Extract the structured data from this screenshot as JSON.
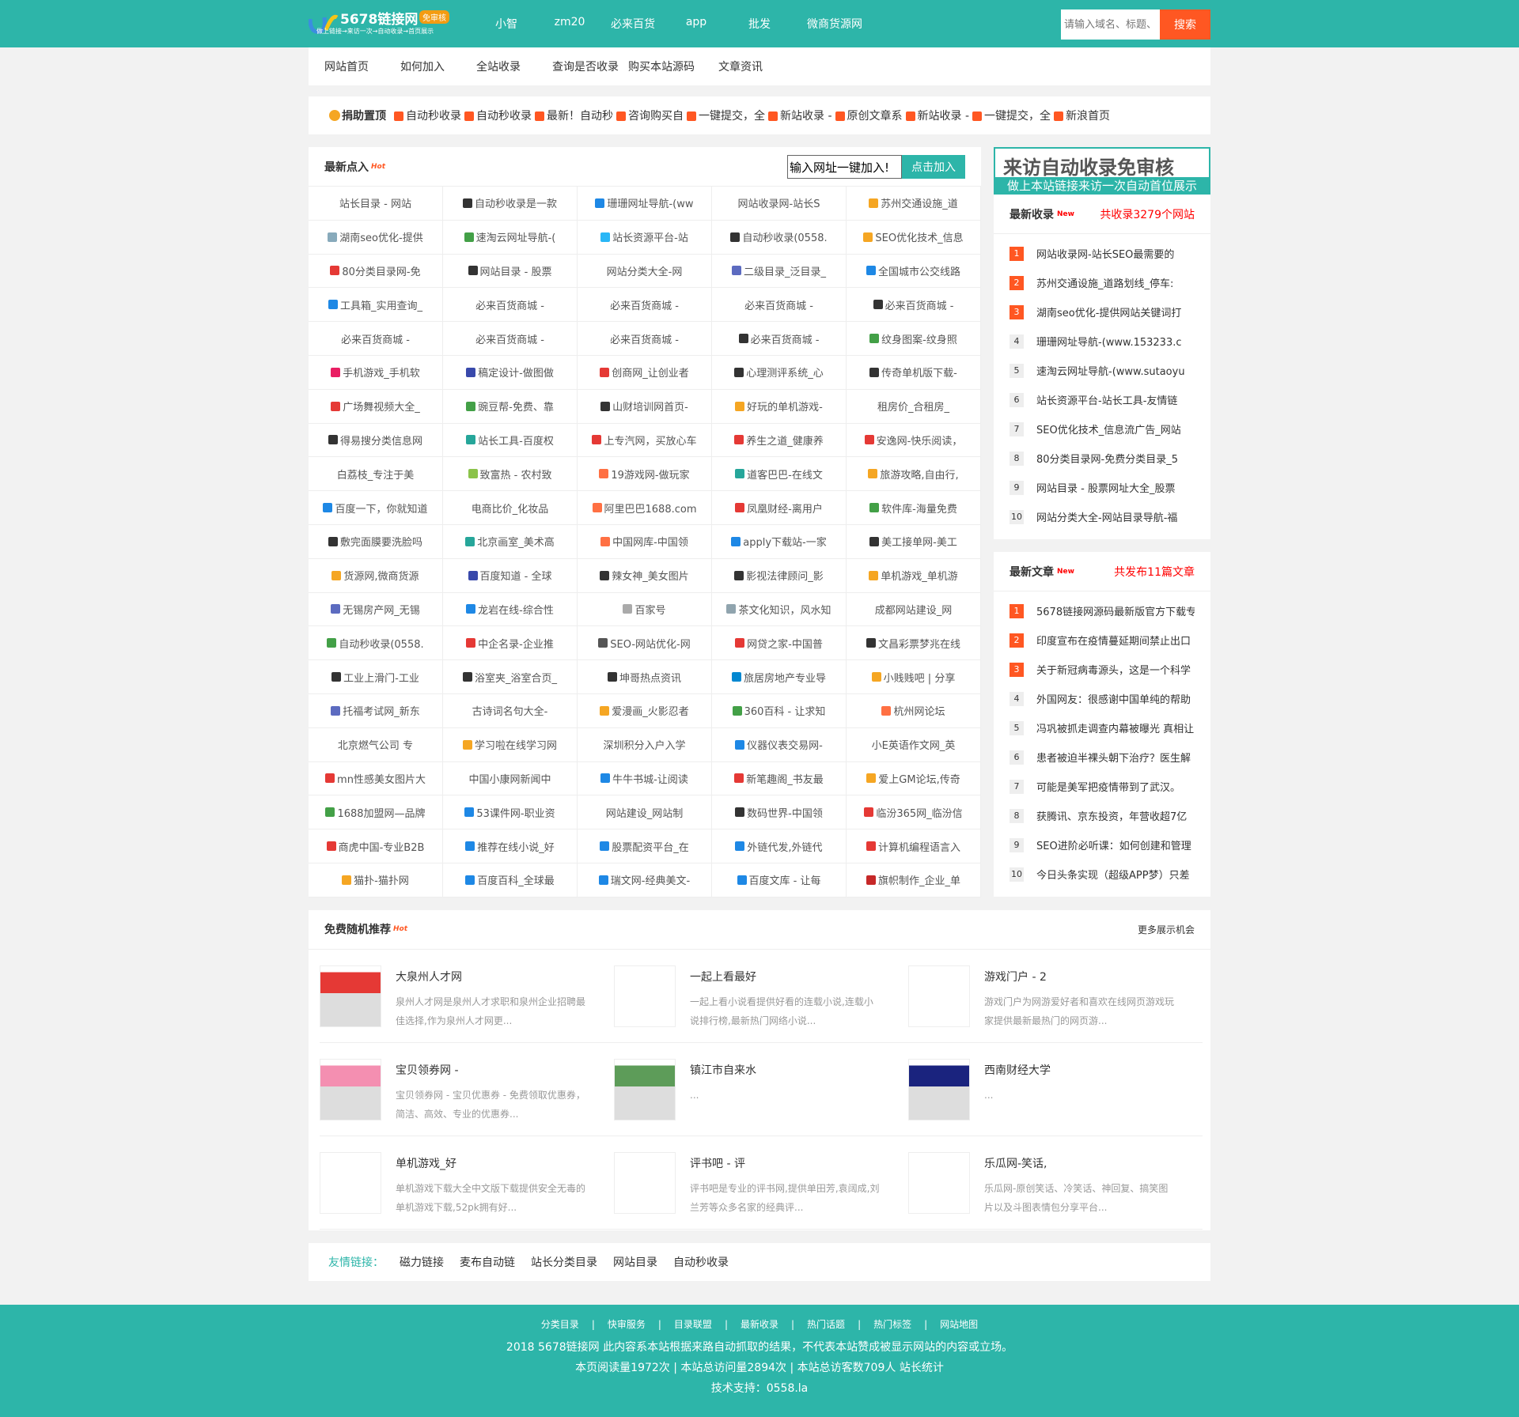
{
  "header": {
    "logo_text": "5678链接网",
    "logo_badge": "免审核",
    "logo_sub": "做上链接→来访一次→自动收录→首页展示",
    "nav": [
      "小智",
      "zm20",
      "必来百货",
      "app",
      "批发",
      "微商货源网"
    ],
    "search_placeholder": "请输入域名、标题、",
    "search_button": "搜索"
  },
  "subnav": [
    "网站首页",
    "如何加入",
    "全站收录",
    "查询是否收录",
    "购买本站源码",
    "文章资讯"
  ],
  "sponsor": {
    "title": "捐助置顶",
    "items": [
      "自动秒收录",
      "自动秒收录",
      "最新！自动秒",
      "咨询购买自",
      "一键提交，全",
      "新站收录 -",
      "原创文章系",
      "新站收录 -",
      "一键提交，全",
      "新浪首页"
    ]
  },
  "latest": {
    "title": "最新点入",
    "hot": "Hot",
    "input_value": "输入网址一键加入!",
    "button": "点击加入",
    "sites": [
      "站长目录 - 网站",
      "自动秒收录是一款",
      "珊珊网址导航-(ww",
      "网站收录网-站长S",
      "苏州交通设施_道",
      "湖南seo优化-提供",
      "速淘云网址导航-(",
      "站长资源平台-站",
      "自动秒收录(0558.",
      "SEO优化技术_信息",
      "80分类目录网-免",
      "网站目录 - 股票",
      "网站分类大全-网",
      "二级目录_泛目录_",
      "全国城市公交线路",
      "工具箱_实用查询_",
      "必来百货商城 -",
      "必来百货商城 -",
      "必来百货商城 -",
      "必来百货商城 -",
      "必来百货商城 -",
      "必来百货商城 -",
      "必来百货商城 -",
      "必来百货商城 -",
      "纹身图案-纹身照",
      "手机游戏_手机软",
      "稿定设计-做图做",
      "创商网_让创业者",
      "心理测评系统_心",
      "传奇单机版下载-",
      "广场舞视频大全_",
      "豌豆帮-免费、靠",
      "山财培训网首页-",
      "好玩的单机游戏-",
      "租房价_合租房_",
      "得易搜分类信息网",
      "站长工具-百度权",
      "上专汽网，买放心车",
      "养生之道_健康养",
      "安逸网-快乐阅读，",
      "白荔枝_专注于美",
      "致富热 - 农村致",
      "19游戏网-做玩家",
      "道客巴巴-在线文",
      "旅游攻略,自由行,",
      "百度一下，你就知道",
      "电商比价_化妆品",
      "阿里巴巴1688.com",
      "凤凰财经-离用户",
      "软件库-海量免费",
      "敷完面膜要洗脸吗",
      "北京画室_美术高",
      "中国网库-中国领",
      "apply下载站-一家",
      "美工接单网-美工",
      "货源网,微商货源",
      "百度知道 - 全球",
      "辣女神_美女图片",
      "影视法律顾问_影",
      "单机游戏_单机游",
      "无锡房产网_无锡",
      "龙岩在线-综合性",
      "百家号",
      "茶文化知识，风水知",
      "成都网站建设_网",
      "自动秒收录(0558.",
      "中企名录-企业推",
      "SEO-网站优化-网",
      "网贷之家-中国普",
      "文昌彩票梦兆在线",
      "工业上滑门-工业",
      "浴室夹_浴室合页_",
      "坤哥热点资讯",
      "旅居房地产专业导",
      "小贱贱吧 | 分享",
      "托福考试网_新东",
      "古诗词名句大全-",
      "爱漫画_火影忍者",
      "360百科 - 让求知",
      "杭州网论坛",
      "北京燃气公司 专",
      "学习啦在线学习网",
      "深圳积分入户入学",
      "仪器仪表交易网-",
      "小E英语作文网_英",
      "mn性感美女图片大",
      "中国小康网新闻中",
      "牛牛书城-让阅读",
      "新笔趣阁_书友最",
      "爱上GM论坛,传奇",
      "1688加盟网—品牌",
      "53课件网-职业资",
      "网站建设_网站制",
      "数码世界-中国领",
      "临汾365网_临汾信",
      "商虎中国-专业B2B",
      "推荐在线小说_好",
      "股票配资平台_在",
      "外链代发,外链代",
      "计算机编程语言入",
      "猫扑-猫扑网",
      "百度百科_全球最",
      "瑞文网-经典美文-",
      "百度文库 - 让每",
      "旗帜制作_企业_单"
    ],
    "icon_colors": [
      "",
      "#333",
      "#1e88e5",
      "",
      "#f5a623",
      "#8ab",
      "#43a047",
      "#29b6f6",
      "#333",
      "#f5a623",
      "#e53935",
      "#333",
      "",
      "#5c6bc0",
      "#1e88e5",
      "#1e88e5",
      "",
      "",
      "",
      "#333",
      "",
      "",
      "",
      "#333",
      "#43a047",
      "#e91e63",
      "#3949ab",
      "#e53935",
      "#333",
      "#333",
      "#e53935",
      "#43a047",
      "#333",
      "#f5a623",
      "",
      "#333",
      "#26a69a",
      "#e53935",
      "#e53935",
      "#e53935",
      "",
      "#8bc34a",
      "#ff7043",
      "#26a69a",
      "#f5a623",
      "#1e88e5",
      "",
      "#ff7043",
      "#e53935",
      "#43a047",
      "#333",
      "#26a69a",
      "#ff7043",
      "#1e88e5",
      "#333",
      "#f5a623",
      "#3949ab",
      "#333",
      "#333",
      "#f5a623",
      "#5c6bc0",
      "#1e88e5",
      "#aaa",
      "#90a4ae",
      "",
      "#43a047",
      "#e53935",
      "#555",
      "#e53935",
      "#333",
      "#333",
      "#333",
      "#333",
      "#0288d1",
      "#f5a623",
      "#5c6bc0",
      "",
      "#f5a623",
      "#43a047",
      "#ff7043",
      "",
      "#f5a623",
      "",
      "#1e88e5",
      "",
      "#e53935",
      "",
      "#1e88e5",
      "#e53935",
      "#f5a623",
      "#43a047",
      "#1e88e5",
      "",
      "#333",
      "#e53935",
      "#e53935",
      "#1e88e5",
      "#1e88e5",
      "#1e88e5",
      "#e53935",
      "#f5a623",
      "#1e88e5",
      "#1e88e5",
      "#1e88e5",
      "#c62828"
    ]
  },
  "banner": {
    "line1": "来访自动收录免审核",
    "line2": "做上本站链接来访一次自动首位展示"
  },
  "newest": {
    "title": "最新收录",
    "badge": "New",
    "count": "共收录3279个网站",
    "items": [
      "网站收录网-站长SEO最需要的",
      "苏州交通设施_道路划线_停车:",
      "湖南seo优化-提供网站关键词打",
      "珊珊网址导航-(www.153233.c",
      "速淘云网址导航-(www.sutaoyu",
      "站长资源平台-站长工具-友情链",
      "SEO优化技术_信息流广告_网站",
      "80分类目录网-免费分类目录_5",
      "网站目录 - 股票网址大全_股票",
      "网站分类大全-网站目录导航-福"
    ]
  },
  "articles": {
    "title": "最新文章",
    "badge": "New",
    "count": "共发布11篇文章",
    "items": [
      "5678链接网源码最新版官方下载专",
      "印度宣布在疫情蔓延期间禁止出口",
      "关于新冠病毒源头，这是一个科学",
      "外国网友：很感谢中国单纯的帮助",
      "冯巩被抓走调查内幕被曝光 真相让",
      "患者被迫半裸头朝下治疗？医生解",
      "可能是美军把疫情带到了武汉。",
      "获腾讯、京东投资，年营收超7亿",
      "SEO进阶必听课：如何创建和管理",
      "今日头条实现（超级APP梦）只差"
    ]
  },
  "recommend": {
    "title": "免费随机推荐",
    "hot": "Hot",
    "more": "更多展示机会",
    "items": [
      {
        "title": "大泉州人才网",
        "desc": "泉州人才网是泉州人才求职和泉州企业招聘最佳选择,作为泉州人才网更..."
      },
      {
        "title": "一起上看最好",
        "desc": "一起上看小说看提供好看的连载小说,连载小说排行榜,最新热门网络小说..."
      },
      {
        "title": "游戏门户 - 2",
        "desc": "游戏门户为网游爱好者和喜欢在线网页游戏玩家提供最新最热门的网页游..."
      },
      {
        "title": "宝贝领券网 -",
        "desc": "宝贝领券网 - 宝贝优惠券 - 免费领取优惠券，简洁、高效、专业的优惠券..."
      },
      {
        "title": "镇江市自来水",
        "desc": "..."
      },
      {
        "title": "西南财经大学",
        "desc": "..."
      },
      {
        "title": "单机游戏_好",
        "desc": "单机游戏下载大全中文版下载提供安全无毒的单机游戏下载,52pk拥有好..."
      },
      {
        "title": "评书吧 - 评",
        "desc": "评书吧是专业的评书网,提供单田芳,袁阔成,刘兰芳等众多名家的经典评..."
      },
      {
        "title": "乐瓜网-笑话,",
        "desc": "乐瓜网-原创笑话、冷笑话、神回复、搞笑图片以及斗图表情包分享平台..."
      }
    ]
  },
  "friends": {
    "label": "友情链接：",
    "links": [
      "磁力链接",
      "麦布自动链",
      "站长分类目录",
      "网站目录",
      "自动秒收录"
    ]
  },
  "footer": {
    "nav": [
      "分类目录",
      "快审服务",
      "目录联盟",
      "最新收录",
      "热门话题",
      "热门标签",
      "网站地图"
    ],
    "sep": "|",
    "line1": "2018 5678链接网 此内容系本站根据来路自动抓取的结果，不代表本站赞成被显示网站的内容或立场。",
    "line2": "本页阅读量1972次 | 本站总访问量2894次 | 本站总访客数709人 站长统计",
    "line3": "技术支持：0558.la"
  }
}
